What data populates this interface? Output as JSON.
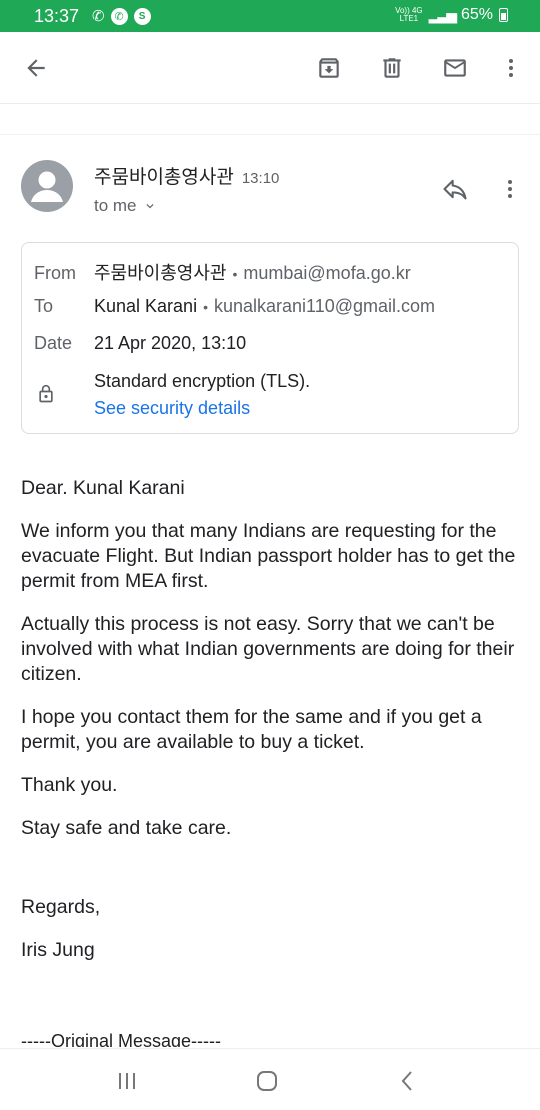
{
  "status_bar": {
    "time": "13:37",
    "network_top": "Vo)) 4G",
    "network_bottom": "LTE1",
    "battery": "65%"
  },
  "toolbar": {
    "icons": [
      "back-icon",
      "archive-icon",
      "delete-icon",
      "mark-unread-icon",
      "more-vert-icon"
    ]
  },
  "email": {
    "sender_name": "주뭄바이총영사관",
    "time": "13:10",
    "to_me": "to me",
    "details": {
      "from_label": "From",
      "from_name": "주뭄바이총영사관",
      "from_email": "mumbai@mofa.go.kr",
      "to_label": "To",
      "to_name": "Kunal Karani",
      "to_email": "kunalkarani110@gmail.com",
      "date_label": "Date",
      "date_value": "21 Apr 2020, 13:10",
      "encryption": "Standard encryption (TLS).",
      "security_link": "See security details",
      "separator": "•"
    },
    "body": {
      "greeting": "Dear. Kunal Karani",
      "p1": "We inform you that many Indians are requesting for the evacuate Flight. But Indian passport holder has to get the permit from MEA first.",
      "p2": "Actually this process is not easy. Sorry that we can't be involved with what Indian governments are doing for their citizen.",
      "p3": "I hope you contact them for the same and if you get a permit, you are available to buy a ticket.",
      "thanks": "Thank you.",
      "stay_safe": "Stay safe and take care.",
      "regards": "Regards,",
      "signature": "Iris Jung",
      "original_message": "-----Original Message-----"
    }
  },
  "colors": {
    "status_bar": "#1fa855",
    "link": "#1a73e8",
    "icon": "#5f6368"
  }
}
